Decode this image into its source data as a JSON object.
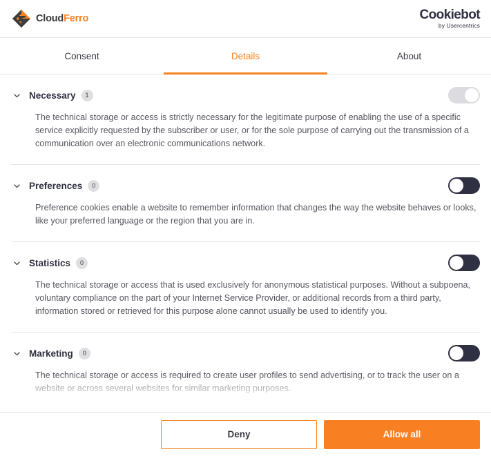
{
  "header": {
    "brand": {
      "name_part1": "Cloud",
      "name_part2": "Ferro",
      "mark_icon": "diamond-logo-icon",
      "colors": {
        "dark": "#3c3c3c",
        "accent": "#f5821f"
      }
    },
    "provider": {
      "title": "Cookiebot",
      "subtitle": "by Usercentrics"
    }
  },
  "tabs": [
    {
      "label": "Consent",
      "active": false
    },
    {
      "label": "Details",
      "active": true
    },
    {
      "label": "About",
      "active": false
    }
  ],
  "categories": [
    {
      "title": "Necessary",
      "count": "1",
      "chevron_icon": "chevron-down-icon",
      "toggle": {
        "state": "on",
        "locked": true
      },
      "description": "The technical storage or access is strictly necessary for the legitimate purpose of enabling the use of a specific service explicitly requested by the subscriber or user, or for the sole purpose of carrying out the transmission of a communication over an electronic communications network."
    },
    {
      "title": "Preferences",
      "count": "0",
      "chevron_icon": "chevron-down-icon",
      "toggle": {
        "state": "off",
        "locked": false
      },
      "description": "Preference cookies enable a website to remember information that changes the way the website behaves or looks, like your preferred language or the region that you are in."
    },
    {
      "title": "Statistics",
      "count": "0",
      "chevron_icon": "chevron-down-icon",
      "toggle": {
        "state": "off",
        "locked": false
      },
      "description": "The technical storage or access that is used exclusively for anonymous statistical purposes. Without a subpoena, voluntary compliance on the part of your Internet Service Provider, or additional records from a third party, information stored or retrieved for this purpose alone cannot usually be used to identify you."
    },
    {
      "title": "Marketing",
      "count": "0",
      "chevron_icon": "chevron-down-icon",
      "toggle": {
        "state": "off",
        "locked": false
      },
      "description": "The technical storage or access is required to create user profiles to send advertising, or to track the user on a website or across several websites for similar marketing purposes."
    }
  ],
  "footer": {
    "deny_label": "Deny",
    "allow_label": "Allow all"
  },
  "theme": {
    "accent": "#f5821f",
    "accent_button": "#f98022",
    "toggle_off_bg": "#2f3042",
    "toggle_locked_bg": "#dcdce0",
    "badge_bg": "#dfdfe2",
    "divider": "#e6e6e8",
    "text": "#3b3b45",
    "heading": "#2f3042"
  }
}
